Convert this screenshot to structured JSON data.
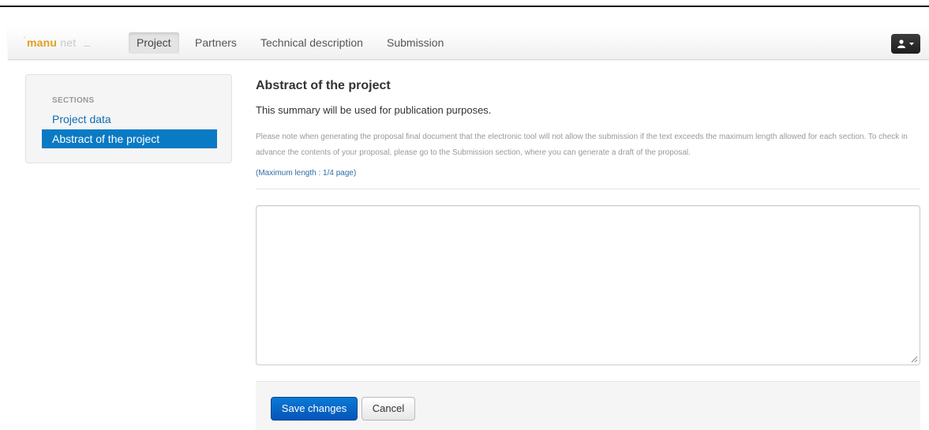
{
  "brand": {
    "part1": "manu",
    "part2": "net"
  },
  "nav": {
    "items": [
      {
        "label": "Project",
        "active": true
      },
      {
        "label": "Partners",
        "active": false
      },
      {
        "label": "Technical description",
        "active": false
      },
      {
        "label": "Submission",
        "active": false
      }
    ],
    "user_icon": "user-icon",
    "caret_icon": "caret-down-icon"
  },
  "sidebar": {
    "header": "SECTIONS",
    "items": [
      {
        "label": "Project data",
        "active": false
      },
      {
        "label": "Abstract of the project",
        "active": true
      }
    ]
  },
  "main": {
    "title": "Abstract of the project",
    "subtitle": "This summary will be used for publication purposes.",
    "note": "Please note when generating the proposal final document that the electronic tool will not allow the submission if the text exceeds the maximum length allowed for each section. To check in advance the contents of your proposal, please go to the Submission section, where you can generate a draft of the proposal.",
    "max_length": "(Maximum length : 1/4 page)",
    "textarea_value": ""
  },
  "actions": {
    "save_label": "Save changes",
    "cancel_label": "Cancel"
  },
  "colors": {
    "accent": "#0a7ac4",
    "link": "#0e6db5",
    "brand": "#e0a020"
  }
}
